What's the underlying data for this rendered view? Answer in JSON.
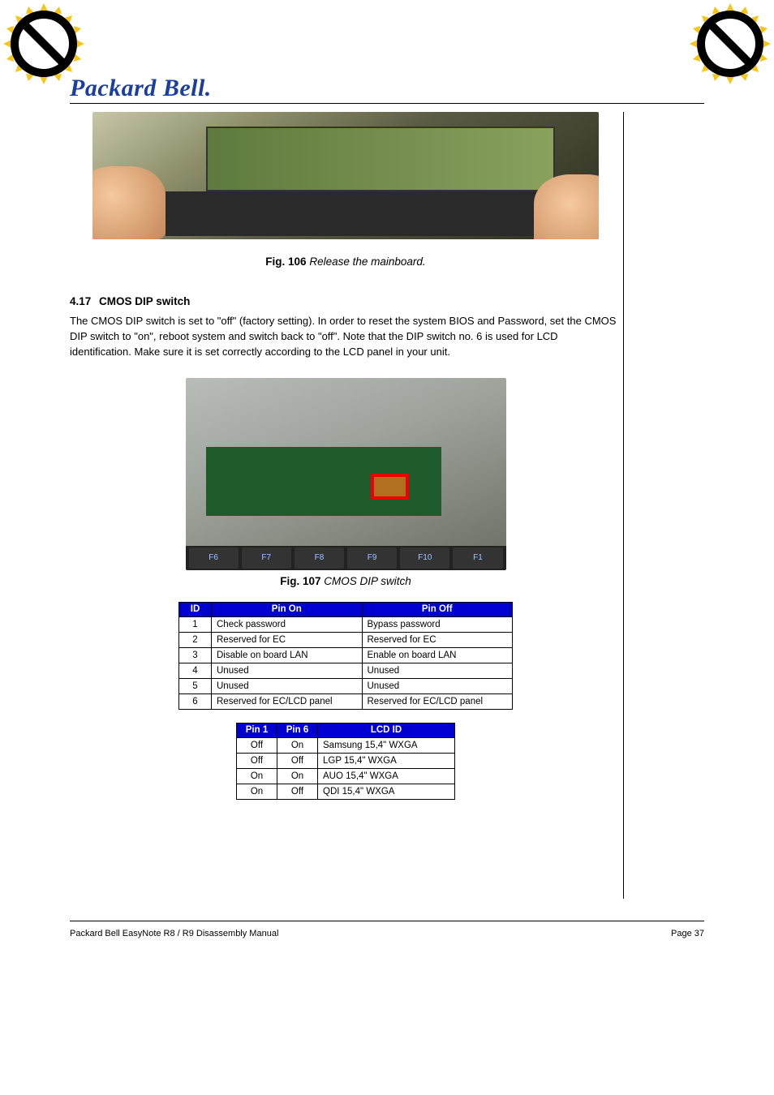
{
  "brand": "Packard Bell.",
  "seal_icon": "prohibit-seal",
  "photo1_alt": "Hands lifting laptop mainboard from chassis",
  "caption1_prefix": "Fig. 106",
  "caption1_text": "Release the mainboard.",
  "section": {
    "number": "4.17",
    "title": "CMOS DIP switch"
  },
  "para1": "The CMOS DIP switch is set to \"off\" (factory setting). In order to reset the system BIOS and Password, set the CMOS DIP switch to \"on\", reboot system and switch back to \"off\". Note that the DIP switch no. 6 is used for LCD identification. Make sure it is set correctly according to the LCD panel in your unit.",
  "photo2_alt": "Close-up of mainboard DIP switch location highlighted in red",
  "keys": [
    "F6",
    "F7",
    "F8",
    "F9",
    "F10",
    "F1"
  ],
  "caption2_prefix": "Fig. 107",
  "caption2_text": "CMOS DIP switch",
  "table1": {
    "headers": [
      "ID",
      "Pin On",
      "Pin Off"
    ],
    "rows": [
      [
        "1",
        "Check password",
        "Bypass password"
      ],
      [
        "2",
        "Reserved for EC",
        "Reserved for EC"
      ],
      [
        "3",
        "Disable on board LAN",
        "Enable on board LAN"
      ],
      [
        "4",
        "Unused",
        "Unused"
      ],
      [
        "5",
        "Unused",
        "Unused"
      ],
      [
        "6",
        "Reserved for EC/LCD panel",
        "Reserved for EC/LCD panel"
      ]
    ]
  },
  "table2": {
    "headers": [
      "Pin 1",
      "Pin 6",
      "LCD ID"
    ],
    "rows": [
      [
        "Off",
        "On",
        "Samsung 15,4\" WXGA"
      ],
      [
        "Off",
        "Off",
        "LGP 15,4\" WXGA"
      ],
      [
        "On",
        "On",
        "AUO 15,4\" WXGA"
      ],
      [
        "On",
        "Off",
        "QDI 15,4\" WXGA"
      ]
    ]
  },
  "footer": {
    "left": "Packard Bell EasyNote R8 / R9 Disassembly Manual",
    "right": "Page 37"
  }
}
